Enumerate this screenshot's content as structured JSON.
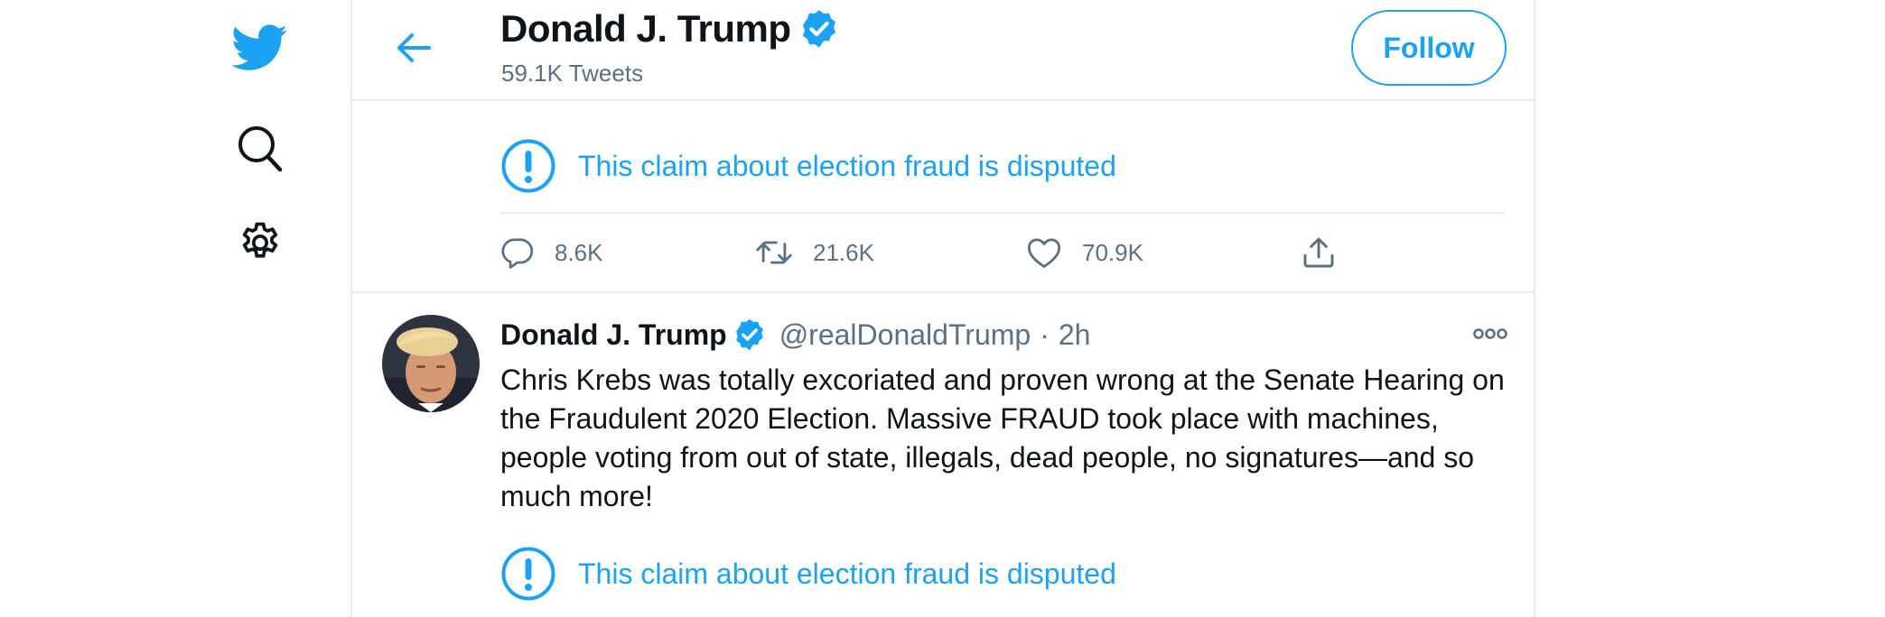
{
  "colors": {
    "accent": "#1da1f2",
    "muted": "#5b7083",
    "text": "#0f1419",
    "divider": "#e8ecee"
  },
  "nav": {
    "items": [
      {
        "icon": "twitter-logo-icon"
      },
      {
        "icon": "search-icon"
      },
      {
        "icon": "gear-icon"
      }
    ]
  },
  "header": {
    "name": "Donald J. Trump",
    "tweet_count": "59.1K Tweets",
    "follow_label": "Follow"
  },
  "previous_tweet": {
    "notice": "This claim about election fraud is disputed",
    "replies": "8.6K",
    "retweets": "21.6K",
    "likes": "70.9K"
  },
  "tweet": {
    "author": "Donald J. Trump",
    "handle": "@realDonaldTrump",
    "dot": "·",
    "time": "2h",
    "text": "Chris Krebs was totally excoriated and proven wrong at the Senate Hearing on the Fraudulent 2020 Election. Massive FRAUD took place with machines, people voting from out of state, illegals, dead people, no signatures—and so much more!",
    "notice": "This claim about election fraud is disputed"
  }
}
